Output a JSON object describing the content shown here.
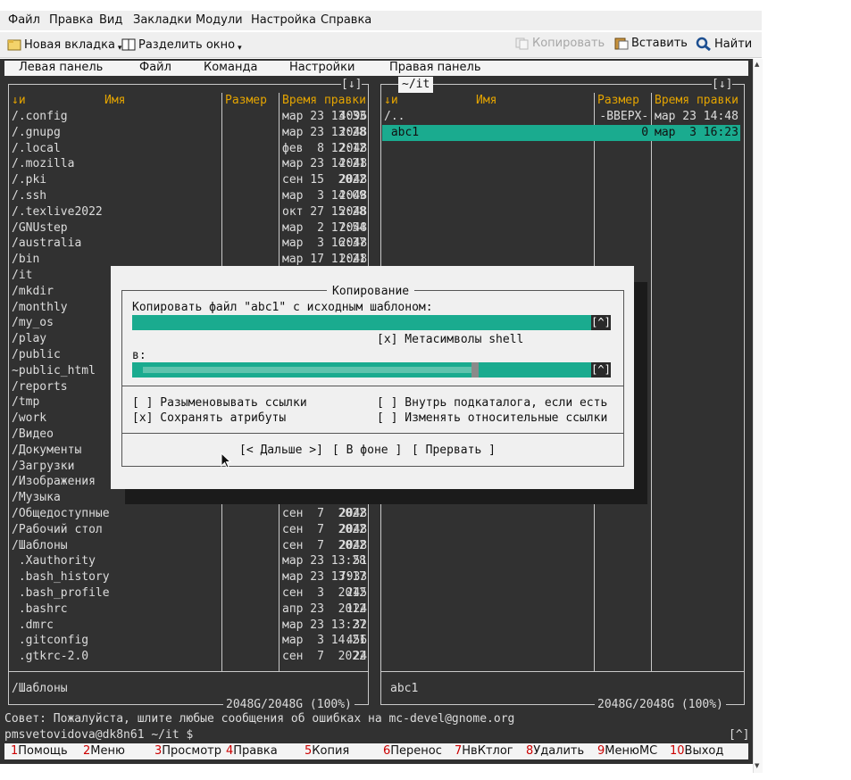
{
  "menubar": [
    "Файл",
    "Правка",
    "Вид",
    "Закладки",
    "Модули",
    "Настройка",
    "Справка"
  ],
  "toolbar": {
    "new_tab": "Новая вкладка",
    "split": "Разделить окно",
    "copy": "Копировать",
    "paste": "Вставить",
    "find": "Найти"
  },
  "mc_menu": [
    "Левая панель",
    "Файл",
    "Команда",
    "Настройки",
    "Правая панель"
  ],
  "left_panel": {
    "top_right": "[↓]",
    "col_sort": "↓и",
    "col_name": "Имя",
    "col_size": "Размер",
    "col_time": "Время правки",
    "rows": [
      {
        "name": "/.config",
        "size": "4096",
        "time": "мар 23 13:33"
      },
      {
        "name": "/.gnupg",
        "size": "2048",
        "time": "мар 23 13:28"
      },
      {
        "name": "/.local",
        "size": "2048",
        "time": "фев  8 12:12"
      },
      {
        "name": "/.mozilla",
        "size": "2048",
        "time": "мар 23 14:21"
      },
      {
        "name": "/.pki",
        "size": "2048",
        "time": "сен 15  2022"
      },
      {
        "name": "/.ssh",
        "size": "2048",
        "time": "мар  3 14:09"
      },
      {
        "name": "/.texlive2022",
        "size": "2048",
        "time": "окт 27 15:28"
      },
      {
        "name": "/GNUstep",
        "size": "2048",
        "time": "мар  2 17:54"
      },
      {
        "name": "/australia",
        "size": "2048",
        "time": "мар  3 16:37"
      },
      {
        "name": "/bin",
        "size": "2048",
        "time": "мар 17 11:21"
      },
      {
        "name": "/it",
        "size": "",
        "time": ""
      },
      {
        "name": "/mkdir",
        "size": "",
        "time": ""
      },
      {
        "name": "/monthly",
        "size": "",
        "time": ""
      },
      {
        "name": "/my_os",
        "size": "",
        "time": ""
      },
      {
        "name": "/play",
        "size": "",
        "time": ""
      },
      {
        "name": "/public",
        "size": "",
        "time": ""
      },
      {
        "name": "~public_html",
        "size": "",
        "time": ""
      },
      {
        "name": "/reports",
        "size": "",
        "time": ""
      },
      {
        "name": "/tmp",
        "size": "",
        "time": ""
      },
      {
        "name": "/work",
        "size": "",
        "time": ""
      },
      {
        "name": "/Видео",
        "size": "",
        "time": ""
      },
      {
        "name": "/Документы",
        "size": "",
        "time": ""
      },
      {
        "name": "/Загрузки",
        "size": "",
        "time": ""
      },
      {
        "name": "/Изображения",
        "size": "",
        "time": ""
      },
      {
        "name": "/Музыка",
        "size": "2048",
        "time": "сен  7  2022"
      },
      {
        "name": "/Общедоступные",
        "size": "2048",
        "time": "сен  7  2022"
      },
      {
        "name": "/Рабочий стол",
        "size": "2048",
        "time": "сен  7  2022"
      },
      {
        "name": "/Шаблоны",
        "size": "2048",
        "time": "сен  7  2022"
      },
      {
        "name": " .Xauthority",
        "size": "51",
        "time": "мар 23 13:28"
      },
      {
        "name": " .bash_history",
        "size": "7933",
        "time": "мар 23 13:17"
      },
      {
        "name": " .bash_profile",
        "size": "245",
        "time": "сен  3  2012"
      },
      {
        "name": " .bashrc",
        "size": "124",
        "time": "апр 23  2012"
      },
      {
        "name": " .dmrc",
        "size": "32",
        "time": "мар 23 13:27"
      },
      {
        "name": " .gitconfig",
        "size": "456",
        "time": "мар  3 14:21"
      },
      {
        "name": " .gtkrc-2.0",
        "size": "24",
        "time": "сен  7  2022"
      }
    ],
    "status": "/Шаблоны",
    "free": "2048G/2048G (100%)"
  },
  "right_panel": {
    "path": "~/it",
    "top_right": "[↓]",
    "col_sort": "↓и",
    "col_name": "Имя",
    "col_size": "Размер",
    "col_time": "Время правки",
    "rows": [
      {
        "name": "/..",
        "size": "-ВВЕРХ-",
        "time": "мар 23 14:48"
      },
      {
        "name": "abc1",
        "size": "0",
        "time": "мар  3 16:23"
      }
    ],
    "status": "abc1",
    "free": "2048G/2048G (100%)"
  },
  "dialog": {
    "title": "Копирование",
    "source_label": "Копировать файл \"abc1\" с исходным шаблоном:",
    "hist": "[^]",
    "shell_meta": "[x] Метасимволы shell",
    "to_label": "в:",
    "opt_deref": "[ ] Разыменовывать ссылки",
    "opt_keep": "[x] Сохранять атрибуты",
    "opt_dive": "[ ] Внутрь подкаталога, если есть",
    "opt_rel": "[ ] Изменять относительные ссылки",
    "btn_next": "[< Дальше >]",
    "btn_bg": "[ В фоне ]",
    "btn_abort": "[ Прервать ]"
  },
  "hint": "Совет: Пожалуйста, шлите любые сообщения об ошибках на mc-devel@gnome.org",
  "prompt": "pmsvetovidova@dk8n61 ~/it $",
  "prompt_hist": "[^]",
  "fkeys": [
    {
      "n": "1",
      "l": "Помощь"
    },
    {
      "n": "2",
      "l": "Меню"
    },
    {
      "n": "3",
      "l": "Просмотр"
    },
    {
      "n": "4",
      "l": "Правка"
    },
    {
      "n": "5",
      "l": "Копия"
    },
    {
      "n": "6",
      "l": "Перенос"
    },
    {
      "n": "7",
      "l": "НвКтлог"
    },
    {
      "n": "8",
      "l": "Удалить"
    },
    {
      "n": "9",
      "l": "МенюMC"
    },
    {
      "n": "10",
      "l": "Выход"
    }
  ],
  "colors": {
    "selection": "#1aab8f",
    "header": "#e4a400",
    "terminal_bg": "#313131",
    "fkey_num": "#cc0000"
  }
}
